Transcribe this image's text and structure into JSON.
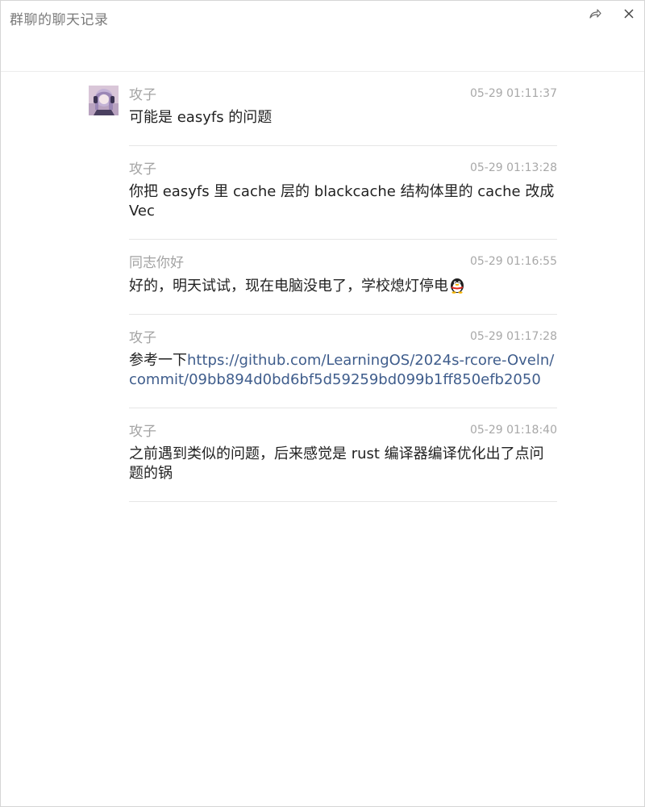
{
  "window": {
    "title": "群聊的聊天记录",
    "share_icon": "share-arrow-icon",
    "close_icon": "close-icon"
  },
  "messages": [
    {
      "sender": "攻子",
      "time": "05-29 01:11:37",
      "text": "可能是 easyfs 的问题",
      "has_avatar": true
    },
    {
      "sender": "攻子",
      "time": "05-29 01:13:28",
      "text": "你把 easyfs 里 cache 层的 blackcache 结构体里的 cache 改成 Vec"
    },
    {
      "sender": "同志你好",
      "time": "05-29 01:16:55",
      "text": "好的，明天试试，现在电脑没电了，学校熄灯停电",
      "emoji": "penguin-emoji"
    },
    {
      "sender": "攻子",
      "time": "05-29 01:17:28",
      "text": "参考一下",
      "link": "https://github.com/LearningOS/2024s-rcore-Oveln/commit/09bb894d0bd6bf5d59259bd099b1ff850efb2050"
    },
    {
      "sender": "攻子",
      "time": "05-29 01:18:40",
      "text": "之前遇到类似的问题，后来感觉是 rust 编译器编译优化出了点问题的锅"
    }
  ],
  "colors": {
    "link": "#3f5d8c",
    "meta": "#a3a3a3",
    "text": "#222222",
    "divider": "#e6e6e6"
  }
}
